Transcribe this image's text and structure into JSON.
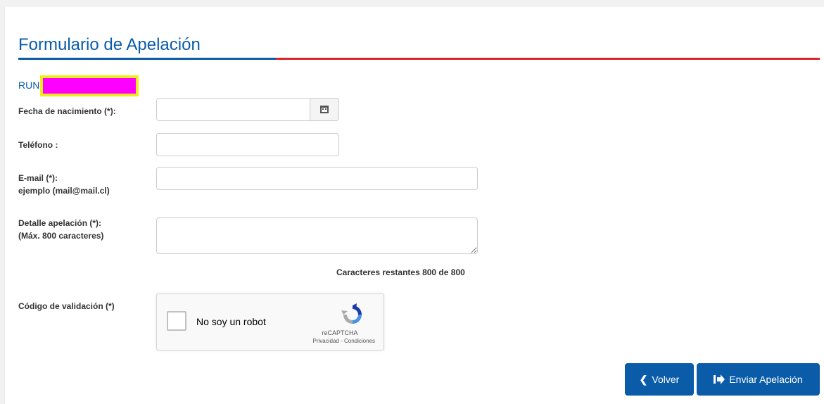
{
  "form": {
    "title": "Formulario de Apelación",
    "run_label": "RUN:",
    "fecha_label": "Fecha de nacimiento (*):",
    "telefono_label": "Teléfono :",
    "email_label": "E-mail (*):",
    "email_hint": "ejemplo (mail@mail.cl)",
    "detalle_label": "Detalle apelación (*):",
    "detalle_hint": "(Máx. 800 caracteres)",
    "counter_text": "Caracteres restantes 800 de 800",
    "codigo_label": "Código de validación (*)"
  },
  "captcha": {
    "text": "No soy un robot",
    "brand": "reCAPTCHA",
    "links": "Privacidad - Condiciones"
  },
  "buttons": {
    "back_label": "Volver",
    "send_label": "Enviar Apelación"
  },
  "icons": {
    "calendar": "calendar-icon",
    "back": "chevron-left-icon",
    "send": "send-icon",
    "recaptcha": "recaptcha-icon"
  },
  "colors": {
    "primary": "#0a5ca8",
    "accent_red": "#d9262b",
    "redaction": "#ff00ff",
    "redaction_border": "#f4ec1a"
  }
}
